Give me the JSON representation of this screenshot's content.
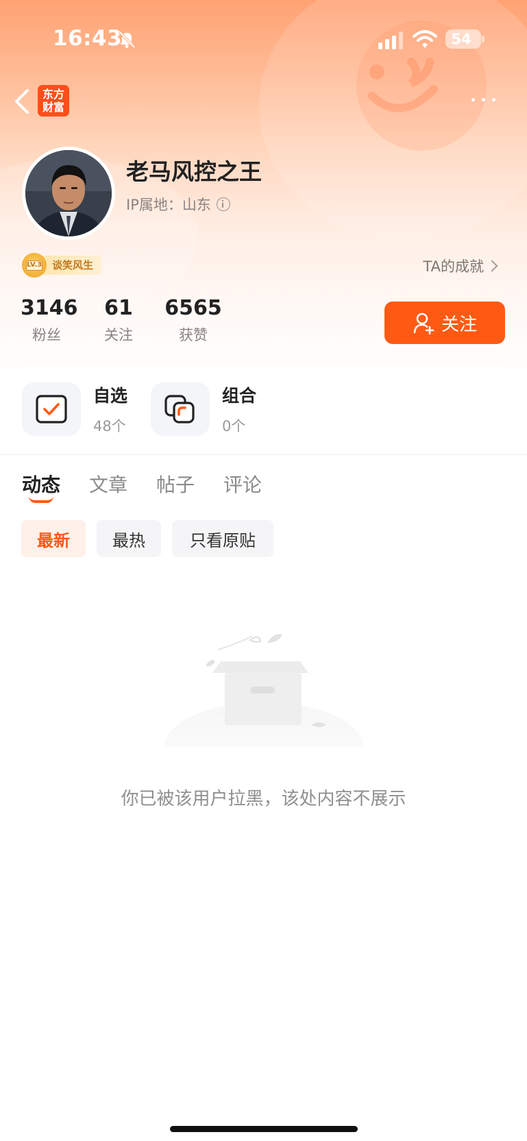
{
  "status_bar": {
    "time": "16:43",
    "battery": "54"
  },
  "app": {
    "logo_line1": "东方",
    "logo_line2": "财富"
  },
  "profile": {
    "name": "老马风控之王",
    "ip_location": "IP属地：山东",
    "level_code": "LV.3",
    "level_title": "谈笑风生",
    "achievements_link": "TA的成就"
  },
  "stats": [
    {
      "value": "3146",
      "label": "粉丝"
    },
    {
      "value": "61",
      "label": "关注"
    },
    {
      "value": "6565",
      "label": "获赞"
    }
  ],
  "follow_button": {
    "label": "关注"
  },
  "shortcuts": [
    {
      "title": "自选",
      "count": "48个",
      "icon": "checkbox-icon"
    },
    {
      "title": "组合",
      "count": "0个",
      "icon": "portfolio-icon"
    }
  ],
  "tabs": [
    "动态",
    "文章",
    "帖子",
    "评论"
  ],
  "active_tab": "动态",
  "filters": [
    "最新",
    "最热",
    "只看原贴"
  ],
  "active_filter": "最新",
  "empty_state": {
    "message": "你已被该用户拉黑，该处内容不展示",
    "icon": "empty-box-icon"
  },
  "colors": {
    "accent": "#ff5a14",
    "header_gradient_top": "#ffa273"
  }
}
